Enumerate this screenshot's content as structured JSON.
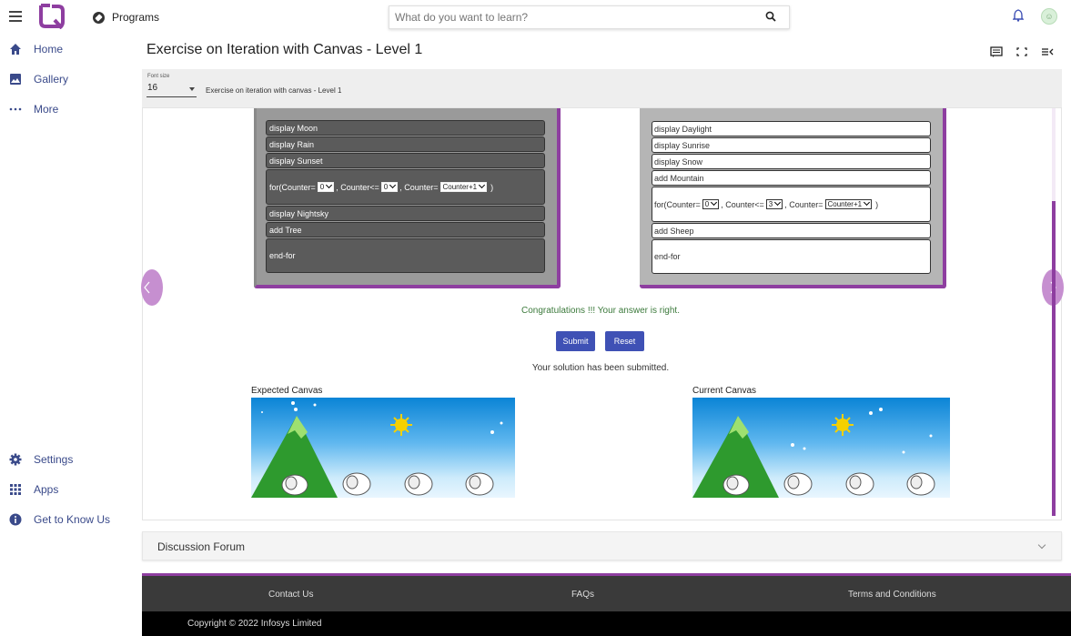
{
  "header": {
    "programs_label": "Programs",
    "search_placeholder": "What do you want to learn?"
  },
  "sidebar": {
    "top_items": [
      {
        "label": "Home",
        "icon": "home-icon"
      },
      {
        "label": "Gallery",
        "icon": "gallery-icon"
      },
      {
        "label": "More",
        "icon": "more-icon"
      }
    ],
    "bottom_items": [
      {
        "label": "Settings",
        "icon": "gear-icon"
      },
      {
        "label": "Apps",
        "icon": "apps-icon"
      },
      {
        "label": "Get to Know Us",
        "icon": "info-icon"
      }
    ]
  },
  "page": {
    "title": "Exercise on Iteration with Canvas - Level 1",
    "font_size_label": "Font size",
    "font_size_value": "16",
    "subtitle": "Exercise on iteration with canvas - Level 1"
  },
  "left_code": {
    "blocks": [
      "display Moon",
      "display Rain",
      "display Sunset"
    ],
    "for_prefix": "for(Counter=",
    "for_mid1": ", Counter<=",
    "for_mid2": ", Counter=",
    "for_suffix": ")",
    "for_init": "0",
    "for_limit": "0",
    "for_step": "Counter+1",
    "after_blocks": [
      "display Nightsky",
      "add Tree"
    ],
    "end": "end-for"
  },
  "right_code": {
    "blocks": [
      "display Daylight",
      "display Sunrise",
      "display Snow",
      "add Mountain"
    ],
    "for_prefix": "for(Counter=",
    "for_mid1": ", Counter<=",
    "for_mid2": ", Counter=",
    "for_suffix": ")",
    "for_init": "0",
    "for_limit": "3",
    "for_step": "Counter+1",
    "after_blocks": [
      "add Sheep"
    ],
    "end": "end-for"
  },
  "result": {
    "success_message": "Congratulations !!! Your answer is right.",
    "submit_label": "Submit",
    "reset_label": "Reset",
    "submitted_message": "Your solution has been submitted."
  },
  "canvases": {
    "expected_label": "Expected Canvas",
    "current_label": "Current Canvas"
  },
  "forum": {
    "title": "Discussion Forum"
  },
  "footer": {
    "contact": "Contact Us",
    "faqs": "FAQs",
    "terms": "Terms and Conditions",
    "copyright": "Copyright © 2022 Infosys Limited"
  },
  "colors": {
    "accent_purple": "#8e3ea0",
    "button_blue": "#3f51b5",
    "success_green": "#3c7a3c"
  }
}
